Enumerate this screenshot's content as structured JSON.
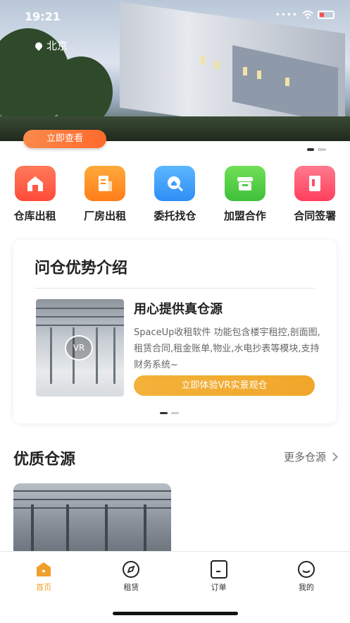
{
  "status_bar": {
    "time": "19:21",
    "dots": "••••"
  },
  "hero": {
    "location": "北京",
    "cta_label": "立即查看"
  },
  "categories": [
    {
      "label": "仓库出租",
      "icon": "warehouse-icon",
      "color": "#ff5b45"
    },
    {
      "label": "厂房出租",
      "icon": "factory-doc-icon",
      "color": "#ff8a1e"
    },
    {
      "label": "委托找仓",
      "icon": "search-house-icon",
      "color": "#3aa0ff"
    },
    {
      "label": "加盟合作",
      "icon": "store-icon",
      "color": "#4fce4a"
    },
    {
      "label": "合同签署",
      "icon": "contract-icon",
      "color": "#ff4d6a"
    }
  ],
  "advantage": {
    "title": "问仓优势介绍",
    "vr_badge": "VR",
    "feature_title": "用心提供真仓源",
    "feature_desc": "SpaceUp收租软件 功能包含楼宇租控,剖面图,租赁合同,租金账单,物业,水电抄表等模块,支持财务系统~",
    "button_label": "立即体验VR实景观仓"
  },
  "quality": {
    "title": "优质仓源",
    "more_label": "更多仓源"
  },
  "tabbar": [
    {
      "label": "首页",
      "icon": "home-icon",
      "active": true
    },
    {
      "label": "租赁",
      "icon": "compass-icon",
      "active": false
    },
    {
      "label": "订单",
      "icon": "order-icon",
      "active": false
    },
    {
      "label": "我的",
      "icon": "profile-icon",
      "active": false
    }
  ],
  "colors": {
    "accent": "#f0a02a",
    "hero_button": "#ff6a2c",
    "vr_button": "#f3b23a"
  }
}
